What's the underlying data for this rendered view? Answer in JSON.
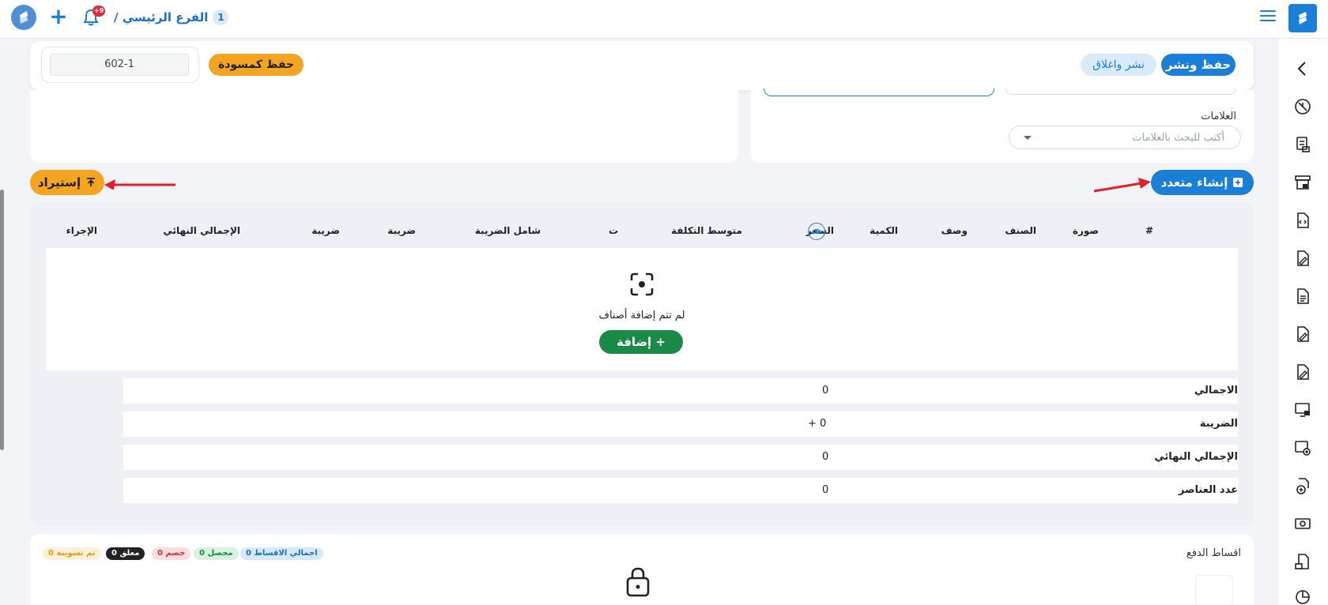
{
  "topbar": {
    "branch_name": "الفرع الرئيسي /",
    "branch_count": "1",
    "notification_badge": "+9"
  },
  "form": {
    "save_publish_label": "حفظ ونشر",
    "publish_close_label": "نشر واغلاق",
    "save_draft_label": "حفظ كمسودة",
    "document_number": "602-1",
    "tags_label": "العلامات",
    "tags_placeholder": "أكتب للبحث بالعلامات"
  },
  "actions": {
    "bulk_create_label": "إنشاء متعدد",
    "import_label": "إستيراد"
  },
  "table": {
    "headers": {
      "index": "#",
      "image": "صورة",
      "item": "الصنف",
      "description": "وصف",
      "quantity": "الكمية",
      "price": "السعر",
      "avg_cost": "متوسط التكلفة",
      "t": "ت",
      "incl_tax": "شامل الضريبة",
      "tax1": "ضريبة",
      "tax2": "ضريبة",
      "final_total": "الإجمالي النهائي",
      "action": "الإجراء"
    },
    "empty_message": "لم تتم إضافة أصناف",
    "add_label": "+ إضافة"
  },
  "summary": [
    {
      "label": "الاجمالي",
      "value": "0"
    },
    {
      "label": "الضريبة",
      "value": "+ 0"
    },
    {
      "label": "الإجمالي النهائي",
      "value": "0"
    },
    {
      "label": "عدد العناصر",
      "value": "0"
    }
  ],
  "installments": {
    "title": "اقساط الدفع",
    "badges": {
      "total": "اجمالي الاقساط 0",
      "collected": "محصل 0",
      "discount": "خصم 0",
      "pending": "معلق 0",
      "settled": "تم تسويته 0"
    }
  },
  "colors": {
    "primary": "#1b7fd8",
    "accent_orange": "#f3a521",
    "success": "#1a8a48",
    "annotation_arrow": "#e0202a"
  }
}
